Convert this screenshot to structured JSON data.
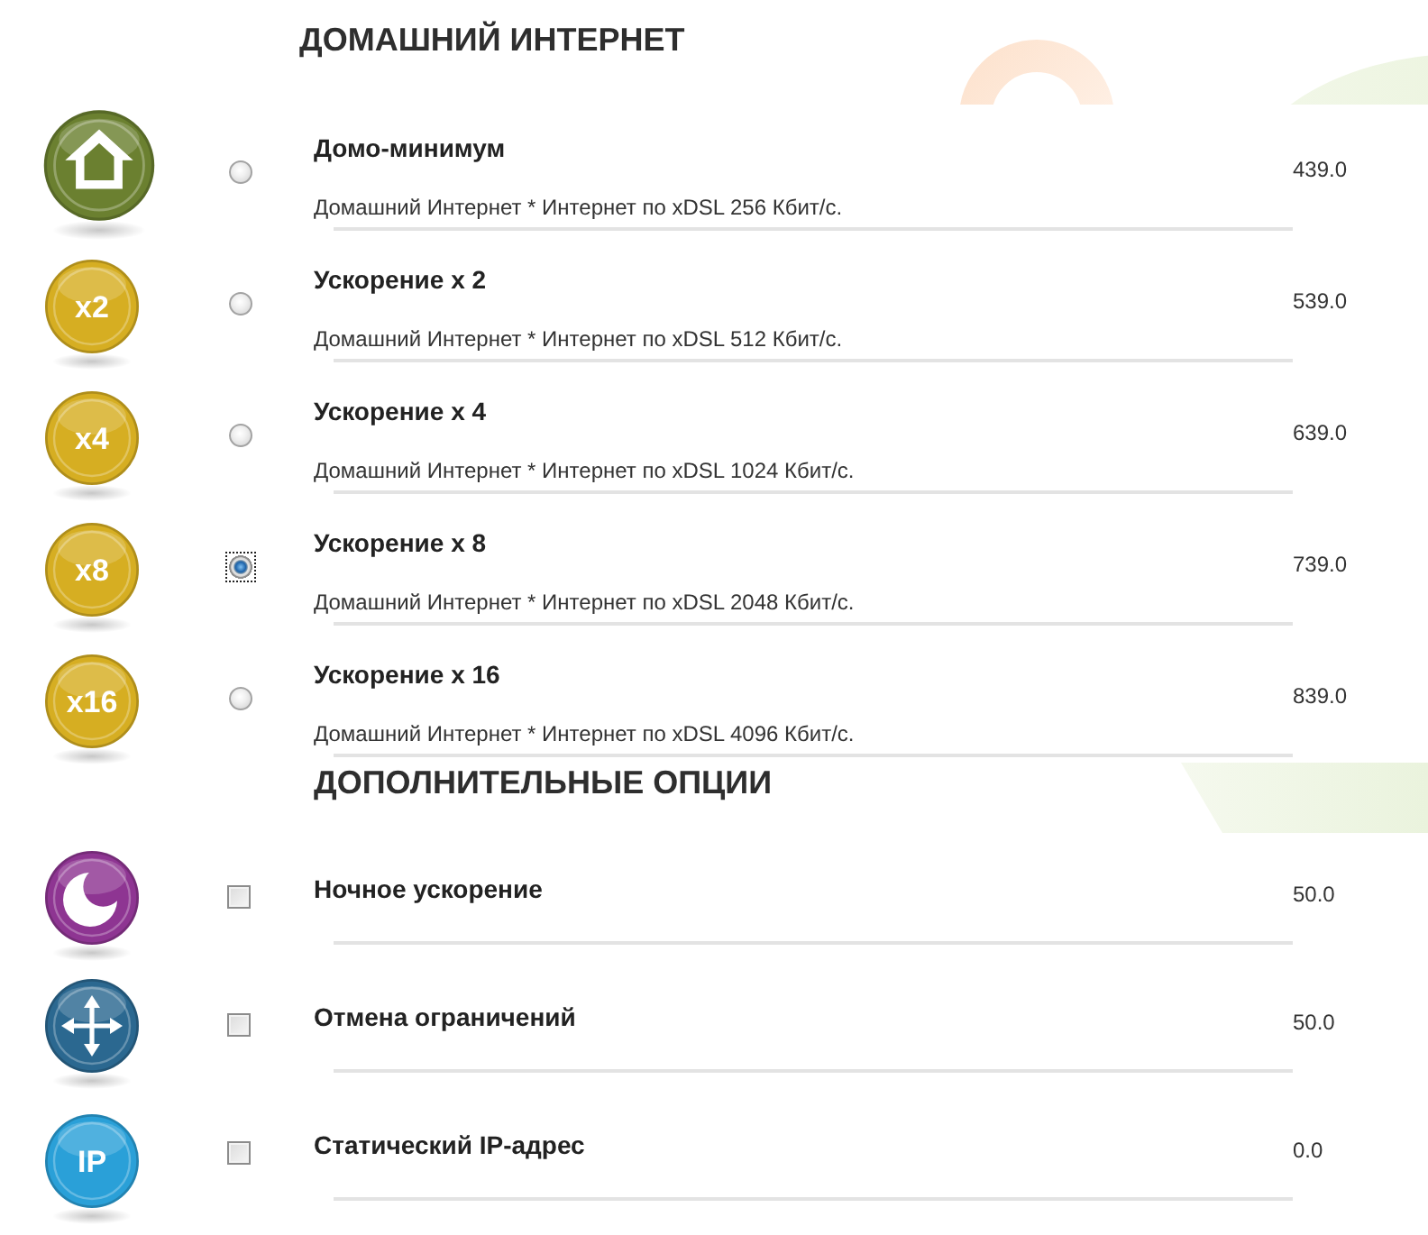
{
  "sections": [
    {
      "kind": "radio",
      "title": "ДОМАШНИЙ ИНТЕРНЕТ",
      "items": [
        {
          "kind": "icon",
          "color": "#6b8030",
          "name": "Домо-минимум",
          "description": "Домашний Интернет * Интернет по xDSL 256 Кбит/с.",
          "price": "439.0",
          "selected": false
        },
        {
          "kind": "label",
          "badge": "x2",
          "color": "#d6ae22",
          "name": "Ускорение x 2",
          "description": "Домашний Интернет * Интернет по xDSL 512 Кбит/с.",
          "price": "539.0",
          "selected": false
        },
        {
          "kind": "label",
          "badge": "x4",
          "color": "#d6ae22",
          "name": "Ускорение x 4",
          "description": "Домашний Интернет * Интернет по xDSL 1024 Кбит/с.",
          "price": "639.0",
          "selected": false
        },
        {
          "kind": "label",
          "badge": "x8",
          "color": "#d6ae22",
          "name": "Ускорение x 8",
          "description": "Домашний Интернет * Интернет по xDSL 2048 Кбит/с.",
          "price": "739.0",
          "selected": true
        },
        {
          "kind": "label",
          "badge": "x16",
          "color": "#d6ae22",
          "name": "Ускорение x 16",
          "description": "Домашний Интернет * Интернет по xDSL 4096 Кбит/с.",
          "price": "839.0",
          "selected": false
        }
      ]
    },
    {
      "kind": "checkbox",
      "title": "ДОПОЛНИТЕЛЬНЫЕ ОПЦИИ",
      "items": [
        {
          "kind": "icon",
          "color": "#8e3592",
          "name": "Ночное ускорение",
          "price": "50.0",
          "checked": false
        },
        {
          "kind": "icon",
          "color": "#2b6890",
          "name": "Отмена ограничений",
          "price": "50.0",
          "checked": false
        },
        {
          "kind": "label",
          "badge": "IP",
          "color": "#2aa0d8",
          "name": "Статический IP-адрес",
          "price": "0.0",
          "checked": false
        }
      ]
    }
  ]
}
